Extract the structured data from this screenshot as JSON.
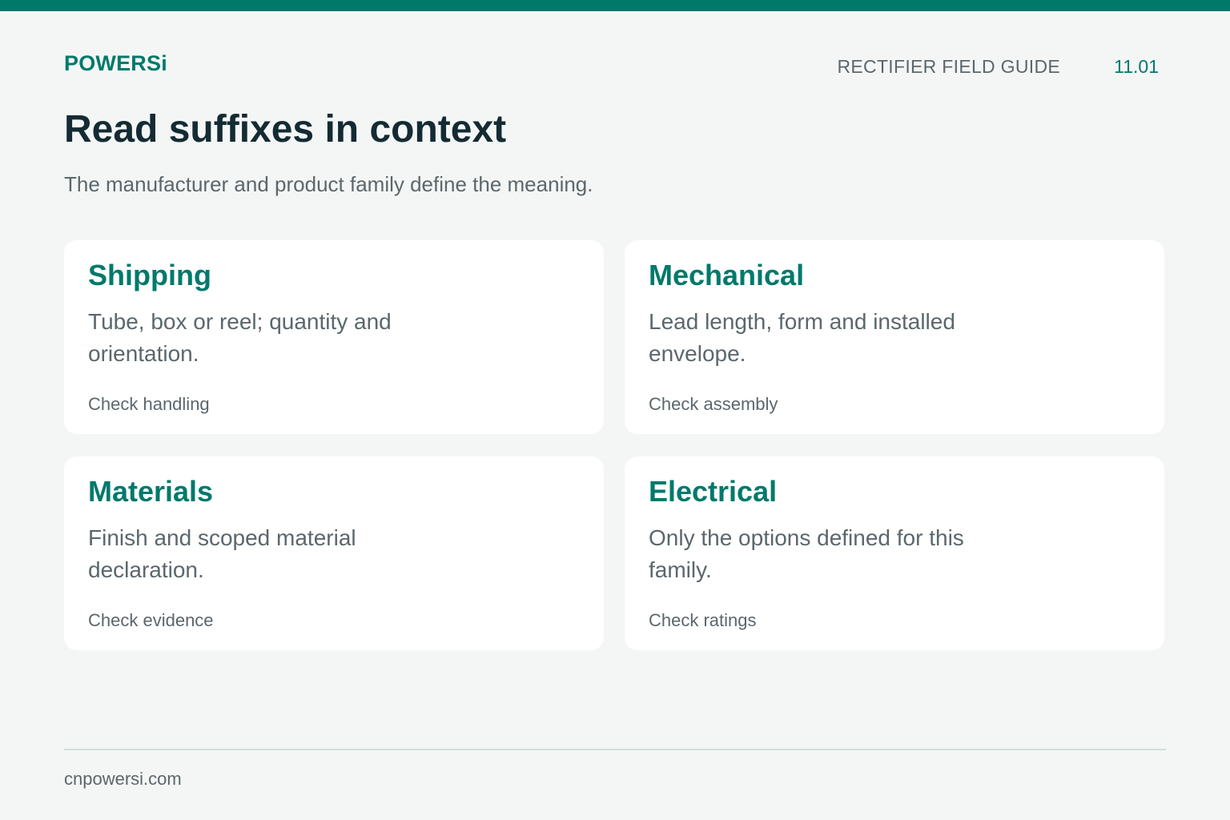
{
  "header": {
    "brand": "POWERSi",
    "guide_title": "RECTIFIER FIELD GUIDE",
    "page_number": "11.01"
  },
  "main": {
    "title": "Read suffixes in context",
    "subtitle": "The manufacturer and product family define the meaning.",
    "cards": [
      {
        "title": "Shipping",
        "body": "Tube, box or reel; quantity and orientation.",
        "footer": "Check handling"
      },
      {
        "title": "Mechanical",
        "body": "Lead length, form and installed envelope.",
        "footer": "Check assembly"
      },
      {
        "title": "Materials",
        "body": "Finish and scoped material declaration.",
        "footer": "Check evidence"
      },
      {
        "title": "Electrical",
        "body": "Only the options defined for this family.",
        "footer": "Check ratings"
      }
    ]
  },
  "footer": {
    "domain": "cnpowersi.com"
  },
  "colors": {
    "accent": "#00796b",
    "background": "#f4f6f5",
    "title": "#142b33",
    "muted_text": "#5b676c"
  }
}
